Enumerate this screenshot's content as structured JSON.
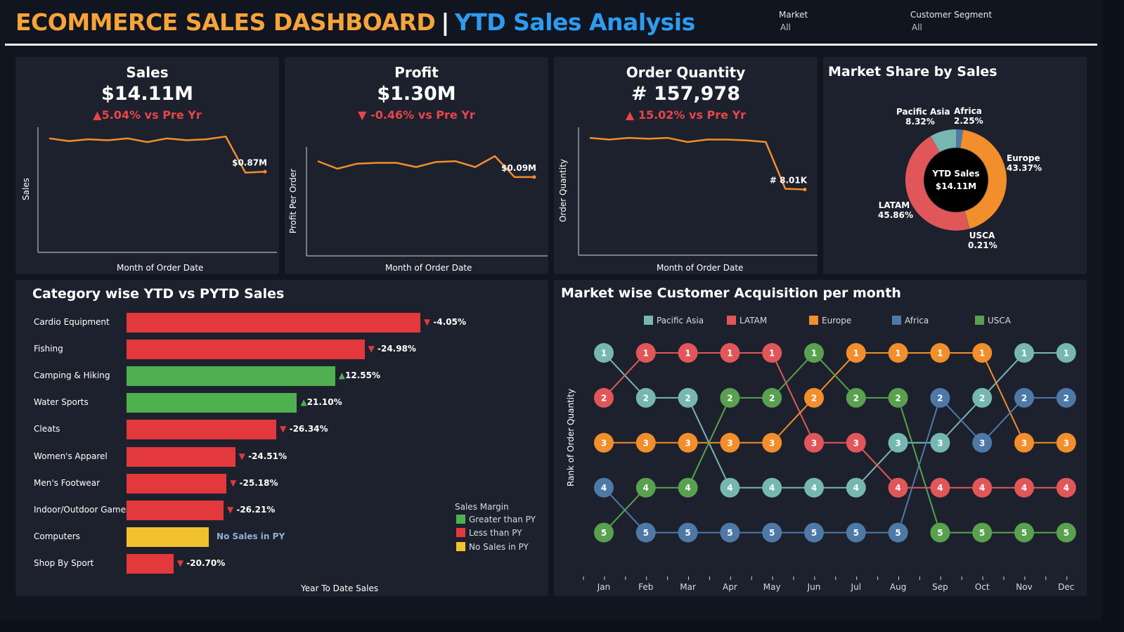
{
  "header": {
    "title_main": "ECOMMERCE SALES DASHBOARD",
    "separator": "|",
    "title_sub": "YTD Sales Analysis",
    "filters": [
      {
        "label": "Market",
        "value": "All"
      },
      {
        "label": "Customer Segment",
        "value": "All"
      }
    ]
  },
  "colors": {
    "orange": "#f28e2b",
    "red": "#e3393c",
    "green": "#4fb04f",
    "yellow": "#f2c12e",
    "teal": "#76b7b2",
    "latam": "#e15759",
    "africa": "#4e79a7",
    "usca": "#59a14f",
    "title_blue": "#2e9bf0"
  },
  "kpis": [
    {
      "title": "Sales",
      "value": "$14.11M",
      "arrow": "▲",
      "delta": "5.04% vs Pre Yr",
      "ylabel": "Sales",
      "xlabel": "Month of Order Date",
      "end_label": "$0.87M",
      "chart_data": {
        "type": "line",
        "x": [
          1,
          2,
          3,
          4,
          5,
          6,
          7,
          8,
          9,
          10,
          11,
          12
        ],
        "values": [
          1.23,
          1.2,
          1.22,
          1.21,
          1.23,
          1.19,
          1.23,
          1.21,
          1.22,
          1.25,
          0.86,
          0.87
        ],
        "ylim": [
          0,
          1.35
        ]
      }
    },
    {
      "title": "Profit",
      "value": "$1.30M",
      "arrow": "▼",
      "delta": "-0.46% vs Pre Yr",
      "ylabel": "Profit Per Order",
      "xlabel": "Month of Order Date",
      "end_label": "$0.09M",
      "chart_data": {
        "type": "line",
        "x": [
          1,
          2,
          3,
          4,
          5,
          6,
          7,
          8,
          9,
          10,
          11,
          12
        ],
        "values": [
          0.113,
          0.104,
          0.11,
          0.111,
          0.111,
          0.106,
          0.112,
          0.113,
          0.106,
          0.119,
          0.094,
          0.094
        ],
        "ylim": [
          0,
          0.13
        ]
      }
    },
    {
      "title": "Order Quantity",
      "value": "# 157,978",
      "arrow": "▲",
      "delta": "15.02% vs Pre Yr",
      "ylabel": "Order Quantity",
      "xlabel": "Month of Order Date",
      "end_label": "# 8.01K",
      "chart_data": {
        "type": "line",
        "x": [
          1,
          2,
          3,
          4,
          5,
          6,
          7,
          8,
          9,
          10,
          11,
          12
        ],
        "values": [
          14.3,
          14.1,
          14.3,
          14.2,
          14.3,
          13.8,
          14.1,
          14.1,
          14.0,
          13.8,
          8.1,
          8.01
        ],
        "ylim": [
          0,
          15.6
        ]
      }
    }
  ],
  "market_share": {
    "title": "Market Share by Sales",
    "center_title": "YTD Sales",
    "center_value": "$14.11M",
    "chart_data": {
      "type": "pie",
      "slices": [
        {
          "name": "Africa",
          "pct": "2.25%",
          "value": 2.25,
          "color": "#4e79a7"
        },
        {
          "name": "Europe",
          "pct": "43.37%",
          "value": 43.37,
          "color": "#f28e2b"
        },
        {
          "name": "USCA",
          "pct": "0.21%",
          "value": 0.21,
          "color": "#59a14f"
        },
        {
          "name": "LATAM",
          "pct": "45.86%",
          "value": 45.86,
          "color": "#e15759"
        },
        {
          "name": "Pacific Asia",
          "pct": "8.32%",
          "value": 8.32,
          "color": "#76b7b2"
        }
      ]
    }
  },
  "category": {
    "title": "Category wise YTD vs PYTD Sales",
    "xlabel": "Year To Date Sales",
    "legend_title": "Sales Margin",
    "legend": [
      {
        "label": "Greater than PY",
        "color": "#4fb04f"
      },
      {
        "label": "Less than PY",
        "color": "#e3393c"
      },
      {
        "label": "No Sales in PY",
        "color": "#f2c12e"
      }
    ],
    "chart_data": {
      "type": "bar",
      "categories": [
        "Cardio Equipment",
        "Fishing",
        "Camping & Hiking",
        "Water Sports",
        "Cleats",
        "Women's Apparel",
        "Men's Footwear",
        "Indoor/Outdoor Games",
        "Computers",
        "Shop By Sport"
      ],
      "values": [
        1.0,
        0.81,
        0.71,
        0.58,
        0.51,
        0.37,
        0.34,
        0.33,
        0.28,
        0.16
      ],
      "labels": [
        "-4.05%",
        "-24.98%",
        "12.55%",
        "21.10%",
        "-26.34%",
        "-24.51%",
        "-25.18%",
        "-26.21%",
        "No Sales in PY",
        "-20.70%"
      ],
      "status": [
        "less",
        "less",
        "greater",
        "greater",
        "less",
        "less",
        "less",
        "less",
        "none",
        "less"
      ]
    }
  },
  "acquisition": {
    "title": "Market wise Customer Acquisition per month",
    "ylabel": "Rank of Order Quantity",
    "legend": [
      {
        "label": "Pacific Asia",
        "color": "#76b7b2"
      },
      {
        "label": "LATAM",
        "color": "#e15759"
      },
      {
        "label": "Europe",
        "color": "#f28e2b"
      },
      {
        "label": "Africa",
        "color": "#4e79a7"
      },
      {
        "label": "USCA",
        "color": "#59a14f"
      }
    ],
    "chart_data": {
      "type": "line",
      "categories": [
        "Jan",
        "Feb",
        "Mar",
        "Apr",
        "May",
        "Jun",
        "Jul",
        "Aug",
        "Sep",
        "Oct",
        "Nov",
        "Dec"
      ],
      "ylim": [
        1,
        5
      ],
      "series": [
        {
          "name": "Pacific Asia",
          "color": "#76b7b2",
          "values": [
            1,
            2,
            2,
            4,
            4,
            4,
            4,
            3,
            3,
            2,
            1,
            1
          ]
        },
        {
          "name": "LATAM",
          "color": "#e15759",
          "values": [
            2,
            1,
            1,
            1,
            1,
            3,
            3,
            4,
            4,
            4,
            4,
            4
          ]
        },
        {
          "name": "Europe",
          "color": "#f28e2b",
          "values": [
            3,
            3,
            3,
            3,
            3,
            2,
            1,
            1,
            1,
            1,
            3,
            3
          ]
        },
        {
          "name": "Africa",
          "color": "#4e79a7",
          "values": [
            4,
            5,
            5,
            5,
            5,
            5,
            5,
            5,
            2,
            3,
            2,
            2
          ]
        },
        {
          "name": "USCA",
          "color": "#59a14f",
          "values": [
            5,
            4,
            4,
            2,
            2,
            1,
            2,
            2,
            5,
            5,
            5,
            5
          ]
        }
      ]
    }
  }
}
